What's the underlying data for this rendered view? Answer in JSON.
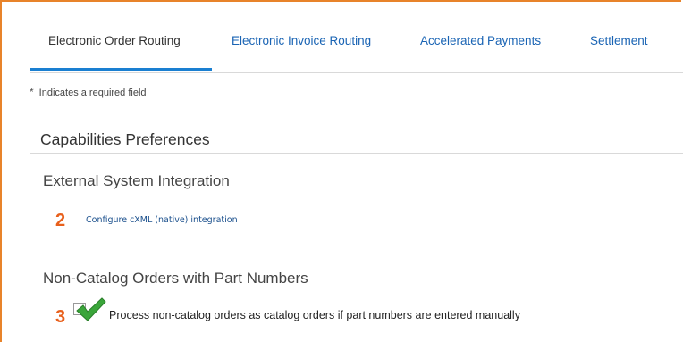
{
  "tabs": [
    {
      "label": "Electronic Order Routing",
      "active": true
    },
    {
      "label": "Electronic Invoice Routing",
      "active": false
    },
    {
      "label": "Accelerated Payments",
      "active": false
    },
    {
      "label": "Settlement",
      "active": false
    }
  ],
  "required_note": {
    "star": "*",
    "text": "Indicates a required field"
  },
  "section_title": "Capabilities Preferences",
  "external": {
    "title": "External System Integration",
    "step": "2",
    "link": "Configure cXML (native) integration"
  },
  "noncatalog": {
    "title": "Non-Catalog Orders with Part Numbers",
    "step": "3",
    "checkbox_label": "Process non-catalog orders as catalog orders if part numbers are entered manually",
    "checked": true
  },
  "colors": {
    "accent_orange": "#e8601c",
    "tab_blue": "#1a64b4",
    "underline_blue": "#1a7fd1",
    "check_green": "#3aa53a"
  }
}
